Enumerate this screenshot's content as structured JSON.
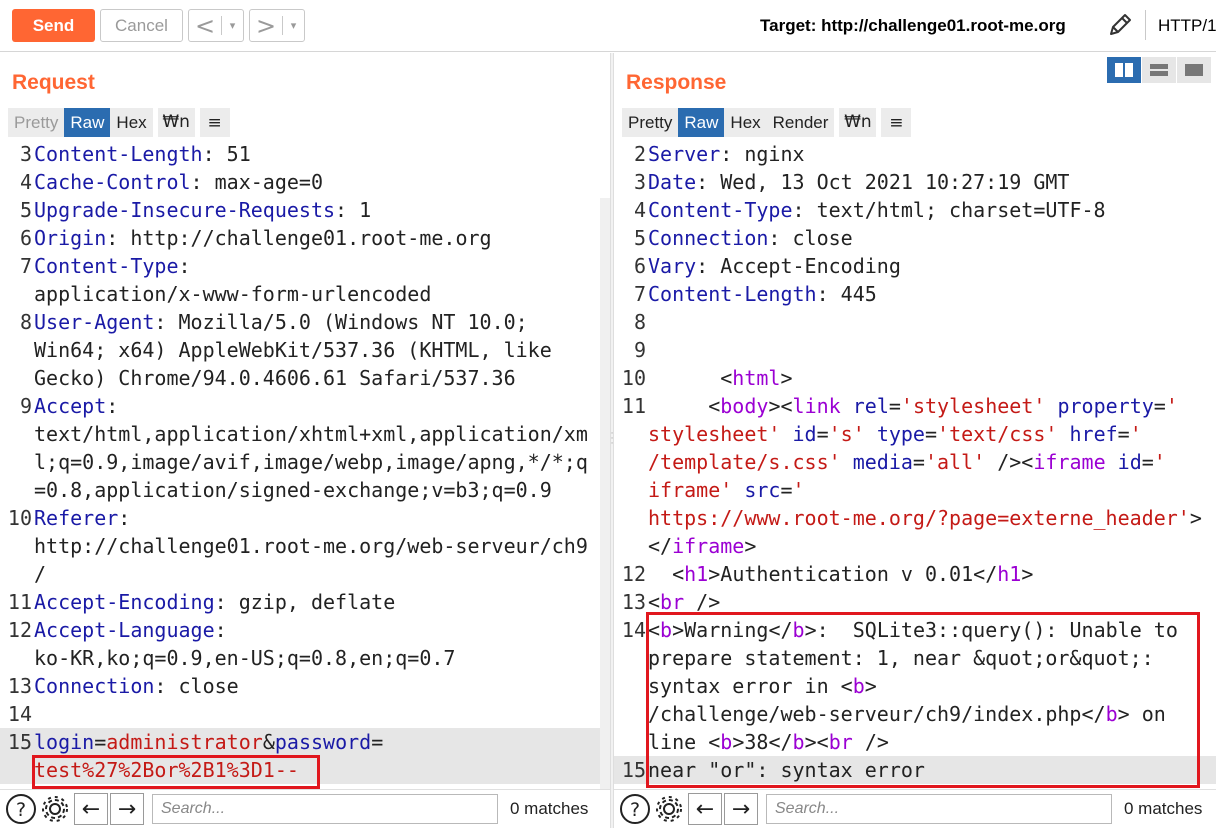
{
  "toolbar": {
    "send_label": "Send",
    "cancel_label": "Cancel",
    "back_glyph": "<",
    "forward_glyph": ">",
    "dropdown_glyph": "▾",
    "target_label": "Target: http://challenge01.root-me.org",
    "protocol_label": "HTTP/1",
    "icons": [
      "pencil-icon"
    ]
  },
  "request": {
    "title": "Request",
    "tabs": {
      "pretty": "Pretty",
      "raw": "Raw",
      "hex": "Hex",
      "wn": "\\n",
      "menu": "≡"
    },
    "active_tab": "Raw",
    "lines": [
      {
        "n": "3",
        "key": "Content-Length",
        "val": ": 51"
      },
      {
        "n": "4",
        "key": "Cache-Control",
        "val": ": max-age=0"
      },
      {
        "n": "5",
        "key": "Upgrade-Insecure-Requests",
        "val": ": 1"
      },
      {
        "n": "6",
        "key": "Origin",
        "val": ": http://challenge01.root-me.org"
      },
      {
        "n": "7",
        "key": "Content-Type",
        "val": ":"
      },
      {
        "n": "",
        "key": "",
        "val": "application/x-www-form-urlencoded"
      },
      {
        "n": "8",
        "key": "User-Agent",
        "val": ": Mozilla/5.0 (Windows NT 10.0;"
      },
      {
        "n": "",
        "key": "",
        "val": "Win64; x64) AppleWebKit/537.36 (KHTML, like"
      },
      {
        "n": "",
        "key": "",
        "val": "Gecko) Chrome/94.0.4606.61 Safari/537.36"
      },
      {
        "n": "9",
        "key": "Accept",
        "val": ":"
      },
      {
        "n": "",
        "key": "",
        "val": "text/html,application/xhtml+xml,application/xm"
      },
      {
        "n": "",
        "key": "",
        "val": "l;q=0.9,image/avif,image/webp,image/apng,*/*;q"
      },
      {
        "n": "",
        "key": "",
        "val": "=0.8,application/signed-exchange;v=b3;q=0.9"
      },
      {
        "n": "10",
        "key": "Referer",
        "val": ":"
      },
      {
        "n": "",
        "key": "",
        "val": "http://challenge01.root-me.org/web-serveur/ch9"
      },
      {
        "n": "",
        "key": "",
        "val": "/"
      },
      {
        "n": "11",
        "key": "Accept-Encoding",
        "val": ": gzip, deflate"
      },
      {
        "n": "12",
        "key": "Accept-Language",
        "val": ":"
      },
      {
        "n": "",
        "key": "",
        "val": "ko-KR,ko;q=0.9,en-US;q=0.8,en;q=0.7"
      },
      {
        "n": "13",
        "key": "Connection",
        "val": ": close"
      },
      {
        "n": "14",
        "key": "",
        "val": ""
      }
    ],
    "body_line_number": "15",
    "body_param1_key": "login",
    "body_param1_eq": "=",
    "body_param1_val": "administrator",
    "body_amp": "&",
    "body_param2_key": "password",
    "body_param2_eq": "=",
    "body_payload": "test%27%2Bor%2B1%3D1--",
    "search": {
      "placeholder": "Search...",
      "matches": "0 matches"
    }
  },
  "response": {
    "title": "Response",
    "tabs": {
      "pretty": "Pretty",
      "raw": "Raw",
      "hex": "Hex",
      "render": "Render",
      "wn": "\\n",
      "menu": "≡"
    },
    "active_tab": "Raw",
    "headers": [
      {
        "n": "2",
        "key": "Server",
        "val": ": nginx"
      },
      {
        "n": "3",
        "key": "Date",
        "val": ": Wed, 13 Oct 2021 10:27:19 GMT"
      },
      {
        "n": "4",
        "key": "Content-Type",
        "val": ": text/html; charset=UTF-8"
      },
      {
        "n": "5",
        "key": "Connection",
        "val": ": close"
      },
      {
        "n": "6",
        "key": "Vary",
        "val": ": Accept-Encoding"
      },
      {
        "n": "7",
        "key": "Content-Length",
        "val": ": 445"
      },
      {
        "n": "8",
        "key": "",
        "val": ""
      },
      {
        "n": "9",
        "key": "",
        "val": ""
      }
    ],
    "html_lines": {
      "l10": {
        "n": "10",
        "indent": "      ",
        "open": "<",
        "tag": "html",
        "close": ">"
      },
      "l11a": {
        "n": "11",
        "indent": "     ",
        "t1": "body",
        "t2": "link",
        "a1": "rel",
        "v1": "'stylesheet'",
        "a2": "property",
        "v2a": "'"
      },
      "l11b": {
        "v2b": "stylesheet'",
        "a3": "id",
        "v3": "'s'",
        "a4": "type",
        "v4": "'text/css'",
        "a5": "href",
        "v5a": "'"
      },
      "l11c": {
        "v5b": "/template/s.css'",
        "a6": "media",
        "v6": "'all'",
        "t3": "iframe",
        "a7": "id",
        "v7a": "'"
      },
      "l11d": {
        "v7b": "iframe'",
        "a8": "src",
        "v8a": "'"
      },
      "l11e": {
        "v8b": "https://www.root-me.org/?page=externe_header'"
      },
      "l11f": {
        "t4": "iframe"
      },
      "l12": {
        "n": "12",
        "indent": "  ",
        "tag": "h1",
        "text": "Authentication v 0.01"
      },
      "l13": {
        "n": "13",
        "tag": "br"
      },
      "l14": {
        "n": "14",
        "b": "b",
        "warning": "Warning",
        "rest1": ":  SQLite3::query(): Unable to",
        "rest2": "prepare statement: 1, near &quot;or&quot;:",
        "rest3": "syntax error in ",
        "path": "/challenge/web-serveur/ch9/index.php",
        "rest4": " on",
        "rest5": "line ",
        "num": "38",
        "br": "br"
      },
      "l15": {
        "n": "15",
        "text": "near \"or\": syntax error"
      }
    },
    "search": {
      "placeholder": "Search...",
      "matches": "0 matches"
    }
  },
  "colors": {
    "accent": "#ff6633",
    "active_tab": "#2b6cb0",
    "header_key": "#1a1aa6",
    "string_value": "#c41a16",
    "tag": "#9b00d3",
    "highlight_box": "#e1171e"
  }
}
